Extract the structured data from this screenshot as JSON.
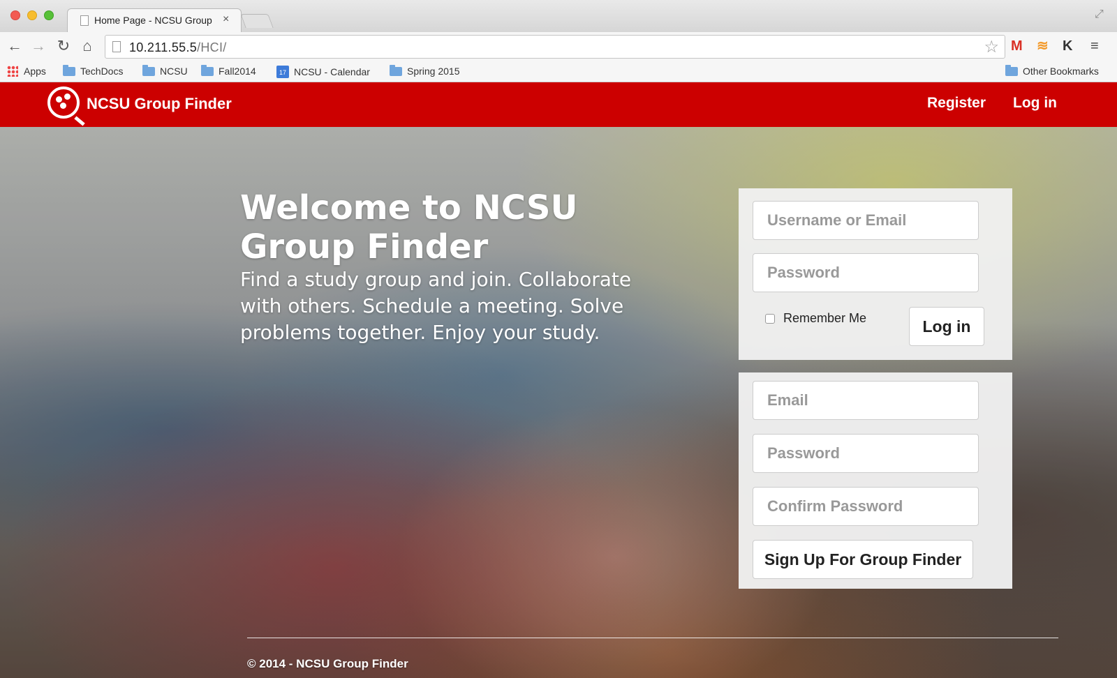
{
  "browser": {
    "tab_title": "Home Page - NCSU Group",
    "tab_close": "×",
    "url_host": "10.211.55.5",
    "url_path": "/HCI/",
    "bookmarks": [
      "Apps",
      "TechDocs",
      "NCSU",
      "Fall2014",
      "NCSU - Calendar",
      "Spring 2015"
    ],
    "calendar_day": "17",
    "other_bookmarks": "Other Bookmarks"
  },
  "header": {
    "site_title": "NCSU Group Finder",
    "register_label": "Register",
    "login_label": "Log in"
  },
  "hero": {
    "welcome": "Welcome to NCSU Group Finder",
    "tagline": "Find a study group and join. Collaborate with others. Schedule a meeting. Solve problems together. Enjoy your study."
  },
  "login_form": {
    "username_placeholder": "Username or Email",
    "password_placeholder": "Password",
    "remember_label": "Remember Me",
    "submit_label": "Log in"
  },
  "signup_form": {
    "email_placeholder": "Email",
    "password_placeholder": "Password",
    "confirm_placeholder": "Confirm Password",
    "submit_label": "Sign Up For Group Finder"
  },
  "footer": {
    "copyright": "© 2014 - NCSU Group Finder"
  },
  "colors": {
    "brand_red": "#cc0000"
  }
}
